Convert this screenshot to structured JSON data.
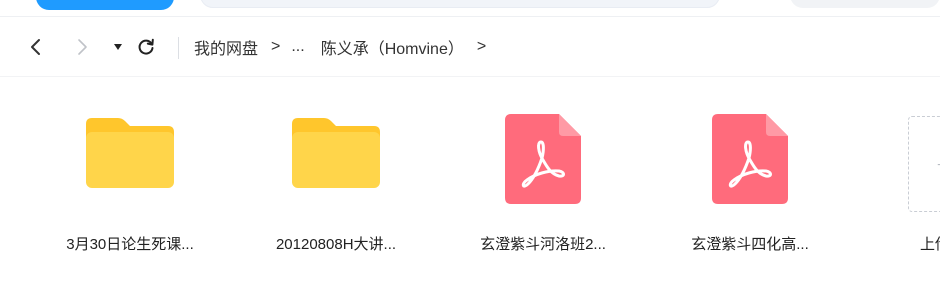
{
  "breadcrumb": {
    "root": "我的网盘",
    "sep1": ">",
    "ellipsis": "...",
    "current": "陈义承（Homvine）",
    "sep2": ">"
  },
  "files": [
    {
      "name": "3月30日论生死课...",
      "type": "folder"
    },
    {
      "name": "20120808H大讲...",
      "type": "folder"
    },
    {
      "name": "玄澄紫斗河洛班2...",
      "type": "pdf"
    },
    {
      "name": "玄澄紫斗四化高...",
      "type": "pdf"
    }
  ],
  "upload": {
    "label": "上传",
    "icon": "plus-icon"
  },
  "colors": {
    "folder": "#ffd54a",
    "folder_tab": "#ffc62c",
    "pdf": "#ff6b7c",
    "accent": "#1f9bff"
  },
  "icons": {
    "back": "chevron-left-icon",
    "forward": "chevron-right-icon",
    "dropdown": "caret-down-icon",
    "refresh": "refresh-icon"
  }
}
